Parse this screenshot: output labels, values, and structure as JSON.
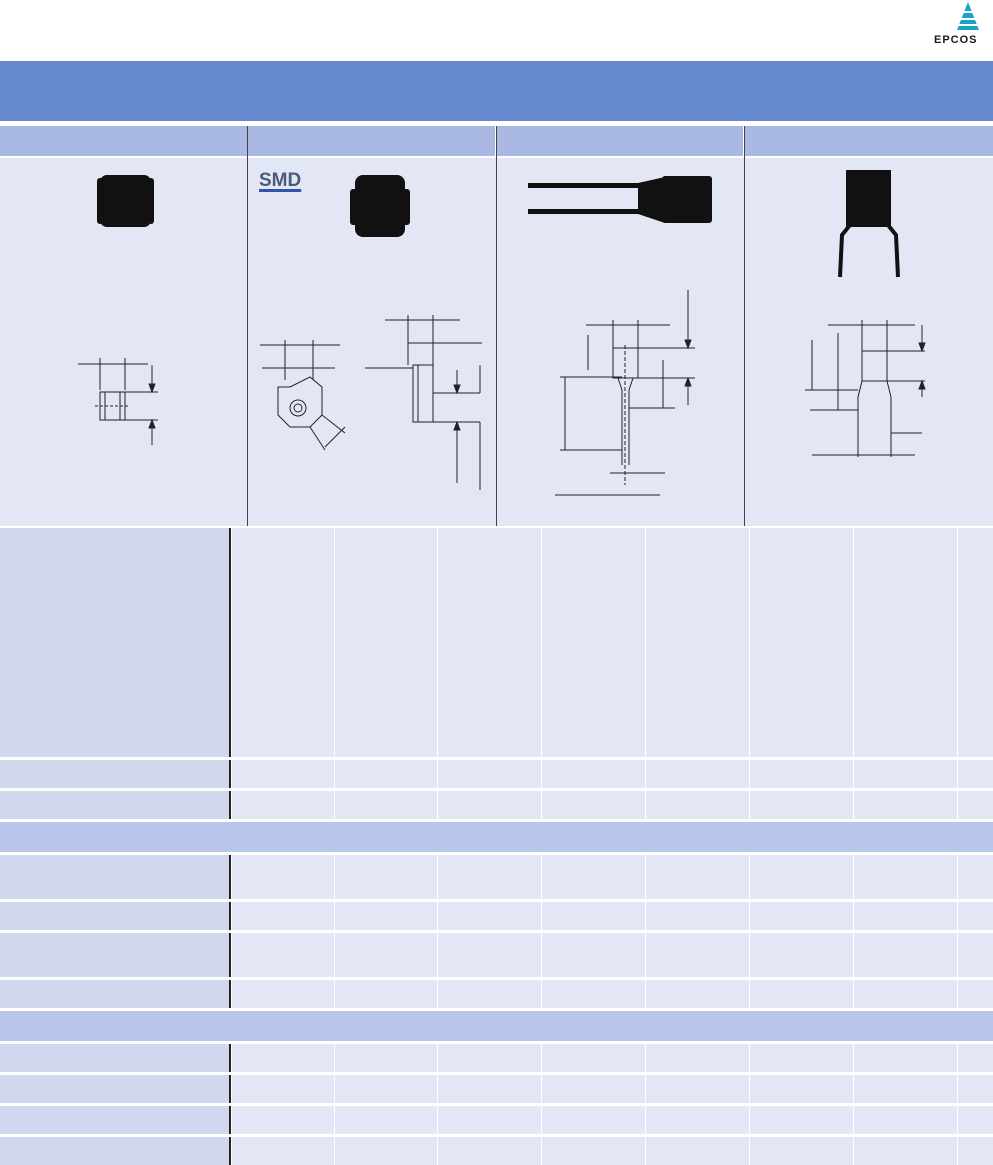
{
  "brand": {
    "logo_text": "EPCOS",
    "logo_color": "#1aa3c8"
  },
  "colors": {
    "title_band": "#6489cf",
    "column_header": "#aab9e3",
    "section_band": "#b9c5ea",
    "label_cell": "#d0d7ef",
    "data_cell": "#e3e7f5"
  },
  "product_columns": [
    {
      "badge": ""
    },
    {
      "badge": "SMD"
    },
    {
      "badge": ""
    },
    {
      "badge": ""
    }
  ],
  "table": {
    "data_columns": 8
  }
}
